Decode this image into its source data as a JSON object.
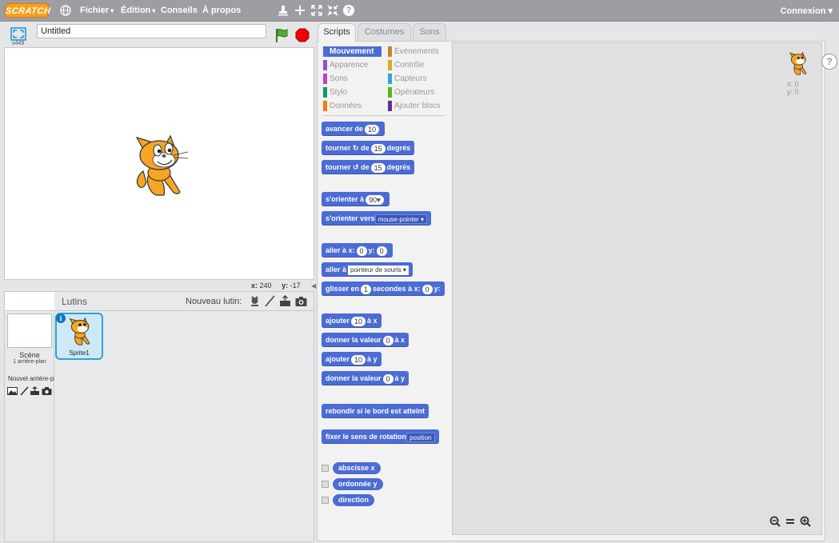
{
  "topbar": {
    "logo": "SCRATCH",
    "menus": [
      {
        "label": "Fichier",
        "caret": "▾"
      },
      {
        "label": "Édition",
        "caret": "▾"
      },
      {
        "label": "Conseils",
        "caret": ""
      },
      {
        "label": "À propos",
        "caret": ""
      }
    ],
    "icons": [
      "stamp-icon",
      "cut-icon",
      "grow-icon",
      "shrink-icon",
      "help-icon"
    ],
    "help_glyph": "?",
    "account": "Connexion ▾"
  },
  "stage": {
    "title_value": "Untitled",
    "version": "v449",
    "coords": {
      "x_label": "x:",
      "x": "240",
      "y_label": "y:",
      "y": "-17"
    }
  },
  "sprites": {
    "header": "Lutins",
    "new_sprite_label": "Nouveau lutin:",
    "scene_label": "Scène",
    "scene_sub": "1 arrière-plan",
    "new_bg_label": "Nouvel arrière-plan:",
    "items": [
      {
        "name": "Sprite1"
      }
    ],
    "info_glyph": "i"
  },
  "tabs": [
    {
      "label": "Scripts",
      "active": true
    },
    {
      "label": "Costumes",
      "active": false
    },
    {
      "label": "Sons",
      "active": false
    }
  ],
  "categories": [
    {
      "label": "Mouvement",
      "color": "#4a6cd4",
      "selected": true
    },
    {
      "label": "Événements",
      "color": "#c88330"
    },
    {
      "label": "Apparence",
      "color": "#8a55d7"
    },
    {
      "label": "Contrôle",
      "color": "#e1a91a"
    },
    {
      "label": "Sons",
      "color": "#bb42c3"
    },
    {
      "label": "Capteurs",
      "color": "#2ca5e2"
    },
    {
      "label": "Stylo",
      "color": "#0e9a6c"
    },
    {
      "label": "Opérateurs",
      "color": "#5cb712"
    },
    {
      "label": "Données",
      "color": "#ee7d16"
    },
    {
      "label": "Ajouter blocs",
      "color": "#632d99"
    }
  ],
  "blocks": {
    "move": {
      "a": "avancer de",
      "n": "10"
    },
    "turn_right": {
      "a": "tourner",
      "b": "de",
      "n": "15",
      "c": "degrés"
    },
    "turn_left": {
      "a": "tourner",
      "b": "de",
      "n": "15",
      "c": "degrés"
    },
    "point_dir": {
      "a": "s'orienter à",
      "n": "90▾"
    },
    "point_towards": {
      "a": "s'orienter vers",
      "d": "mouse-pointer ▾"
    },
    "goto_xy": {
      "a": "aller à x:",
      "n1": "0",
      "b": "y:",
      "n2": "0"
    },
    "goto": {
      "a": "aller à",
      "d": "pointeur de souris ▾"
    },
    "glide": {
      "a": "glisser en",
      "n1": "1",
      "b": "secondes à x:",
      "n2": "0",
      "c": "y:"
    },
    "change_x": {
      "a": "ajouter",
      "n": "10",
      "b": "à x"
    },
    "set_x": {
      "a": "donner la valeur",
      "n": "0",
      "b": "à x"
    },
    "change_y": {
      "a": "ajouter",
      "n": "10",
      "b": "à y"
    },
    "set_y": {
      "a": "donner la valeur",
      "n": "0",
      "b": "à y"
    },
    "bounce": {
      "a": "rebondir si le bord est atteint"
    },
    "rotation": {
      "a": "fixer le sens de rotation",
      "d": "position"
    },
    "rep_x": "abscisse x",
    "rep_y": "ordonnée y",
    "rep_dir": "direction"
  },
  "canvas": {
    "x": "x: 0",
    "y": "y: 0"
  },
  "side_help": "?",
  "colors": {
    "motion": "#4a6cd4",
    "topbar": "#9c9ea2",
    "accent": "#f9a01b"
  }
}
